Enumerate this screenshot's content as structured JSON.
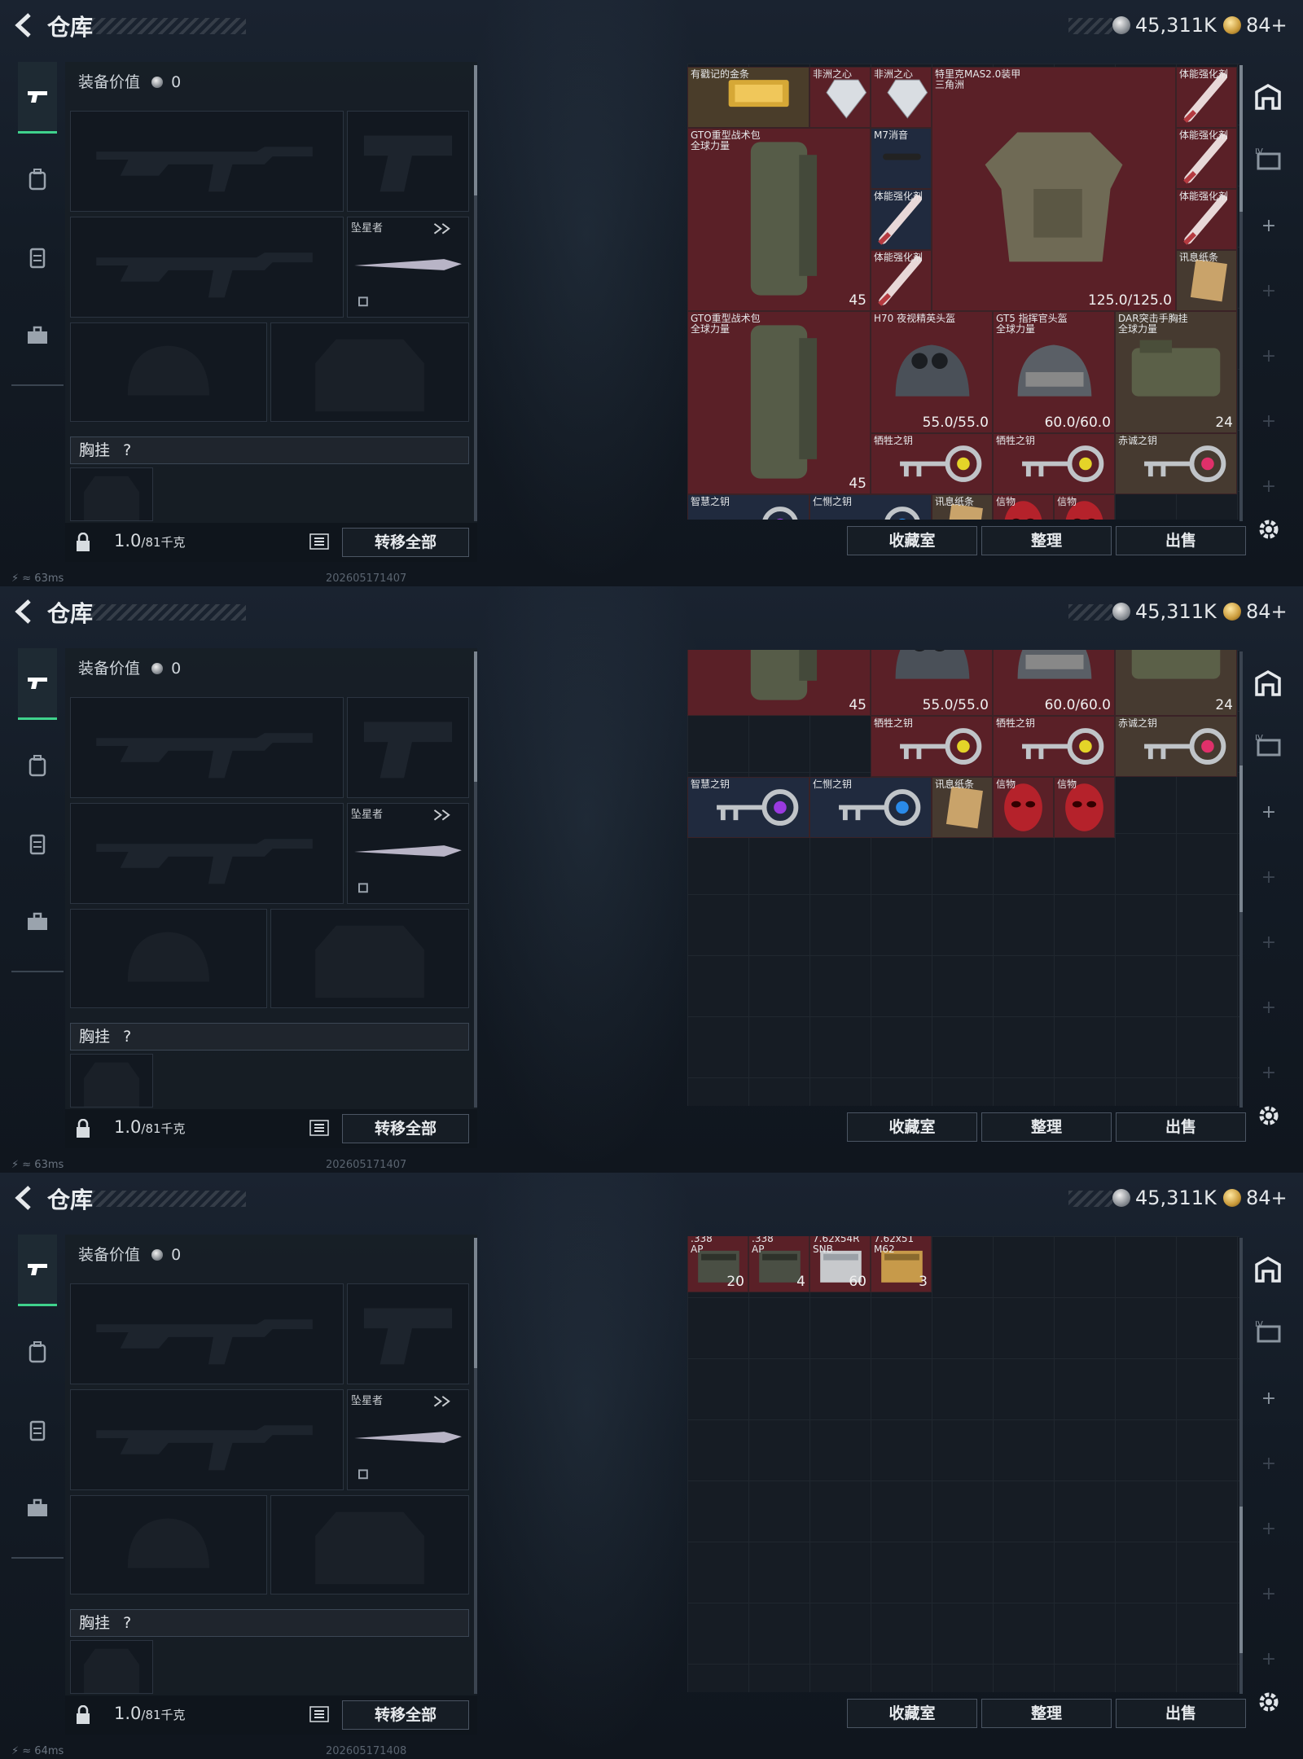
{
  "colors": {
    "accent": "#3fd28c",
    "item_red": "#5a2027",
    "item_blue": "#202a3e"
  },
  "panels": [
    {
      "title": "仓库",
      "currency": {
        "silver": "45,311K",
        "gold": "84+"
      },
      "equipment_value_label": "装备价值",
      "equipment_value": "0",
      "melee_name": "坠星者",
      "chest_label": "胸挂",
      "chest_help": "?",
      "weight_value": "1.0",
      "weight_unit": "/81千克",
      "transfer_all": "转移全部",
      "buttons": {
        "collection": "收藏室",
        "sort": "整理",
        "sell": "出售"
      },
      "ping": "63ms",
      "timestamp": "202605171407",
      "items": {
        "gold": "有戳记的金条",
        "heart1": "非洲之心",
        "heart2": "非洲之心",
        "armor": "特里克MAS2.0装甲",
        "armor_sub": "三角洲",
        "armor_dur": "125.0/125.0",
        "stim1": "体能强化剂",
        "stim2": "体能强化剂",
        "stim3": "体能强化剂",
        "stim4": "体能强化剂",
        "stim5": "体能强化剂",
        "pack1": "GTO重型战术包",
        "pack1_sub": "全球力量",
        "pack1_ct": "45",
        "m7": "M7消音",
        "note": "讯息纸条",
        "pack2": "GTO重型战术包",
        "pack2_sub": "全球力量",
        "pack2_ct": "45",
        "h70": "H70 夜视精英头盔",
        "h70_dur": "55.0/55.0",
        "gt5": "GT5 指挥官头盔",
        "gt5_sub": "全球力量",
        "gt5_dur": "60.0/60.0",
        "dar": "DAR突击手胸挂",
        "dar_sub": "全球力量",
        "dar_ct": "24",
        "key1": "牺牲之钥",
        "key2": "牺牲之钥",
        "key3": "赤诚之钥",
        "key4": "智慧之钥",
        "key5": "仁恻之钥",
        "note2": "讯息纸条",
        "token1": "信物",
        "token2": "信物"
      }
    },
    {
      "title": "仓库",
      "currency": {
        "silver": "45,311K",
        "gold": "84+"
      },
      "equipment_value_label": "装备价值",
      "equipment_value": "0",
      "melee_name": "坠星者",
      "chest_label": "胸挂",
      "chest_help": "?",
      "weight_value": "1.0",
      "weight_unit": "/81千克",
      "transfer_all": "转移全部",
      "buttons": {
        "collection": "收藏室",
        "sort": "整理",
        "sell": "出售"
      },
      "ping": "63ms",
      "timestamp": "202605171407",
      "items": {
        "pack_ct": "45",
        "h70_dur": "55.0/55.0",
        "gt5_dur": "60.0/60.0",
        "dar_ct": "24",
        "key1": "牺牲之钥",
        "key2": "牺牲之钥",
        "key3": "赤诚之钥",
        "key4": "智慧之钥",
        "key5": "仁恻之钥",
        "note": "讯息纸条",
        "token1": "信物",
        "token2": "信物"
      }
    },
    {
      "title": "仓库",
      "currency": {
        "silver": "45,311K",
        "gold": "84+"
      },
      "equipment_value_label": "装备价值",
      "equipment_value": "0",
      "melee_name": "坠星者",
      "chest_label": "胸挂",
      "chest_help": "?",
      "weight_value": "1.0",
      "weight_unit": "/81千克",
      "transfer_all": "转移全部",
      "buttons": {
        "collection": "收藏室",
        "sort": "整理",
        "sell": "出售"
      },
      "ping": "64ms",
      "timestamp": "202605171408",
      "items": {
        "ammo1": ".338",
        "ammo1_sub": "AP",
        "ammo1_ct": "20",
        "ammo2": ".338",
        "ammo2_sub": "AP",
        "ammo2_ct": "4",
        "ammo3": "7.62x54R",
        "ammo3_sub": "SNB",
        "ammo3_ct": "60",
        "ammo4": "7.62x51",
        "ammo4_sub": "M62",
        "ammo4_ct": "3"
      }
    }
  ]
}
